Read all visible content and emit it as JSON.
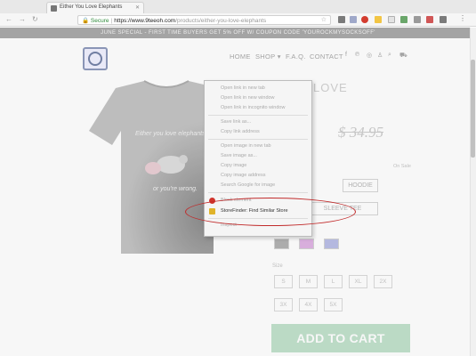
{
  "browser": {
    "tab_title": "Either You Love Elephants",
    "url_secure": "Secure",
    "url_host": "https://www.9teeoh.com",
    "url_path": "/products/either-you-love-elephants"
  },
  "store": {
    "promo": "JUNE SPECIAL - FIRST TIME BUYERS GET 5% OFF W/ COUPON CODE 'YOUROCKMYSOCKSOFF'",
    "nav": [
      "HOME",
      "SHOP",
      "F.A.Q.",
      "CONTACT"
    ],
    "shop_caret": "▾",
    "product_title": "LOVE",
    "old_price": "$ 34.95",
    "on_sale": "On Sale",
    "styles": [
      "HOODIE",
      "SLEEVE TEE"
    ],
    "sizes_label": "Size",
    "sizes_row1": [
      "S",
      "M",
      "L",
      "XL",
      "2X"
    ],
    "sizes_row2": [
      "3X",
      "4X",
      "5X"
    ],
    "add_to_cart": "ADD TO CART",
    "shirt_text_1": "Either you love elephants",
    "shirt_text_2": "or you're wrong.",
    "swatch_colors": [
      "#a4a4a4",
      "#d9a7df",
      "#aeb2e2"
    ]
  },
  "context_menu": {
    "items": [
      {
        "label": "Open link in new tab"
      },
      {
        "label": "Open link in new window"
      },
      {
        "label": "Open link in incognito window"
      },
      {
        "label": "Save link as..."
      },
      {
        "label": "Copy link address"
      },
      {
        "label": "Open image in new tab"
      },
      {
        "label": "Save image as..."
      },
      {
        "label": "Copy image"
      },
      {
        "label": "Copy image address"
      },
      {
        "label": "Search Google for image"
      },
      {
        "label": "Block element"
      },
      {
        "label": "StoreFinder: Find Similar Store"
      },
      {
        "label": "Inspect"
      }
    ]
  },
  "colors": {
    "highlight": "#c12a2a",
    "cart_button": "#b6dcc3",
    "promo_bar": "#9a9a9a"
  }
}
